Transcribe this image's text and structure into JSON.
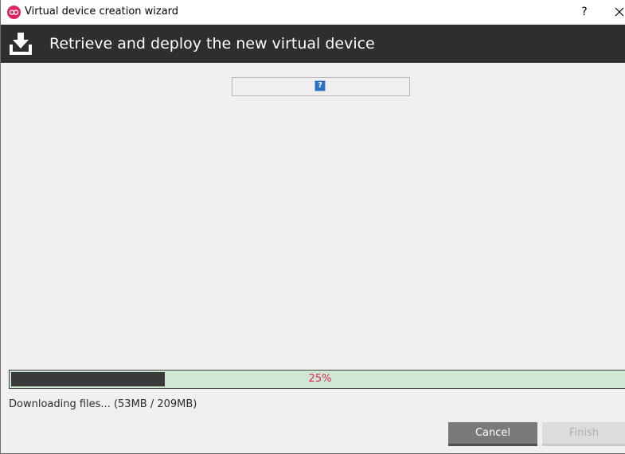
{
  "window": {
    "title": "Virtual device creation wizard",
    "help_label": "?",
    "app_icon": "genymotion-logo",
    "close_icon": "close-icon"
  },
  "header": {
    "title": "Retrieve and deploy the new virtual device",
    "icon": "download-tray-icon"
  },
  "content": {
    "image_placeholder_icon": "broken-image-icon",
    "image_placeholder_glyph": "?"
  },
  "progress": {
    "percent": 25,
    "label": "25%"
  },
  "status": {
    "text": "Downloading files... (53MB / 209MB)"
  },
  "buttons": {
    "cancel_label": "Cancel",
    "finish_label": "Finish"
  },
  "colors": {
    "header_bg": "#2e2e2e",
    "accent": "#e0245e",
    "progress_track": "#cfe8d3",
    "progress_fill": "#3a3a3a"
  }
}
